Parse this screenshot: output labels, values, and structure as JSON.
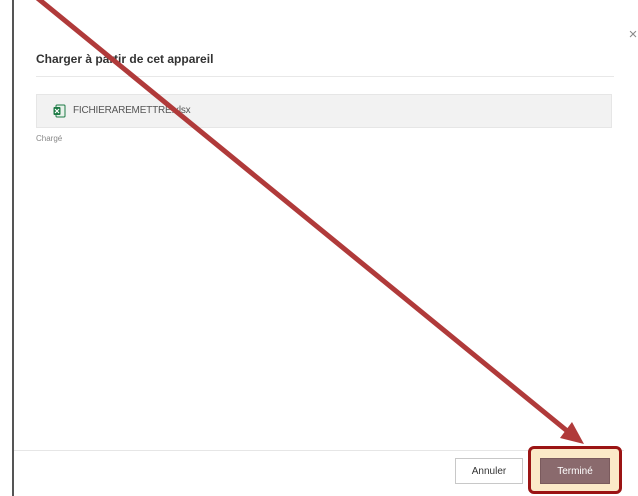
{
  "dialog": {
    "title": "Charger à partir de cet appareil",
    "close_symbol": "×",
    "close_icon": "close-icon"
  },
  "file": {
    "name": "FICHIERAREMETTRE.xlsx",
    "icon": "excel-file-icon",
    "status": "Chargé"
  },
  "footer": {
    "cancel_label": "Annuler",
    "done_label": "Terminé"
  },
  "annotation": {
    "arrow_color": "#b03a3a",
    "highlight_border_color": "#9b1414",
    "highlight_fill_color": "#fbe9c8"
  },
  "colors": {
    "done_button": "#8a6a6d",
    "excel_green": "#1d7a45"
  }
}
